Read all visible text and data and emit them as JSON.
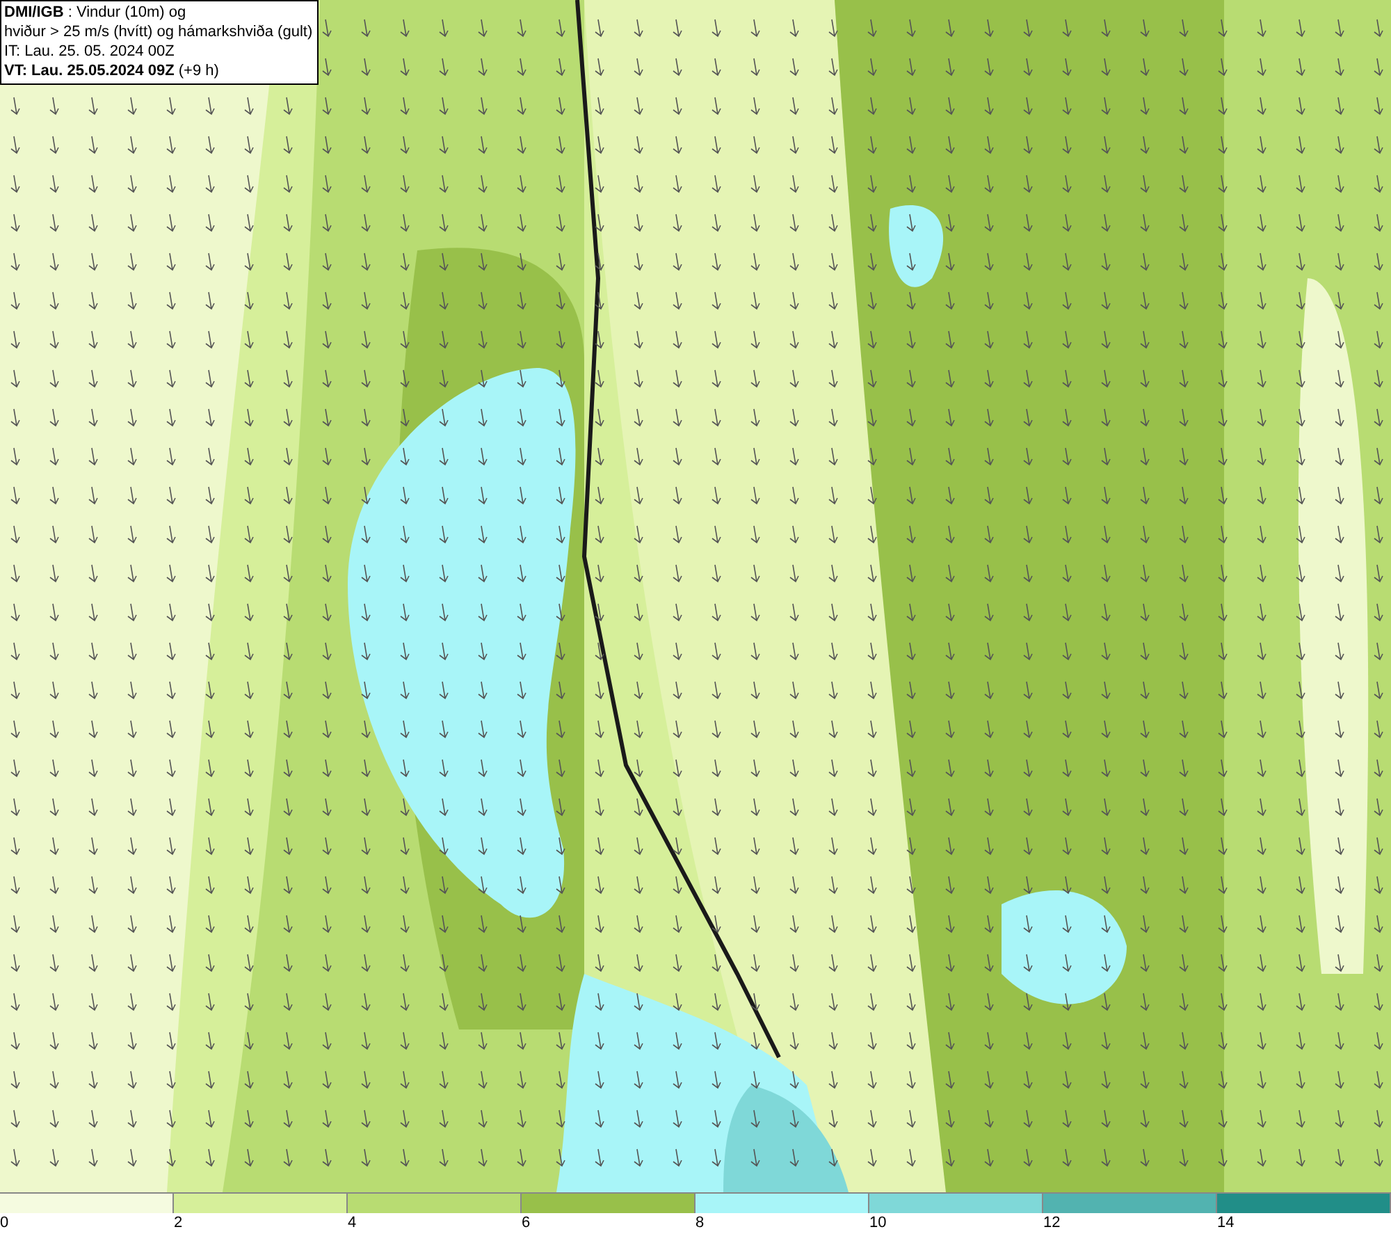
{
  "title_box": {
    "lines": [
      "**DMI/IGB** : Vindur (10m) og",
      "hviður > 25 m/s (hvítt) og hámarkshviða (gult)",
      "IT: Lau. 25. 05. 2024 00Z",
      "**VT: Lau. 25.05.2024 09Z** (+9 h)"
    ]
  },
  "legend": {
    "segments": [
      {
        "label": "0",
        "color": "#f5fbe0"
      },
      {
        "label": "2",
        "color": "#d6ef9a"
      },
      {
        "label": "4",
        "color": "#b8dc72"
      },
      {
        "label": "6",
        "color": "#98c04a"
      },
      {
        "label": "8",
        "color": "#a8f5f8"
      },
      {
        "label": "10",
        "color": "#7fd8d8"
      },
      {
        "label": "12",
        "color": "#52b3b0"
      },
      {
        "label": "14",
        "color": "#218e88"
      }
    ]
  }
}
